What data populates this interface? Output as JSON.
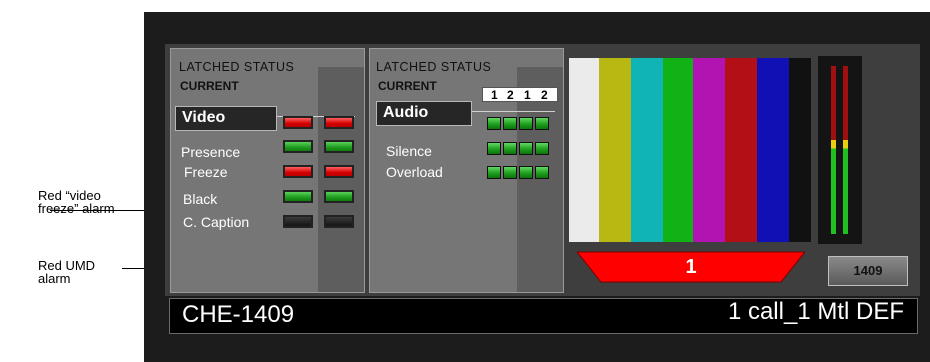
{
  "callouts": {
    "freeze_alarm": "Red “video freeze” alarm",
    "umd_alarm": "Red UMD alarm"
  },
  "video_panel": {
    "header": "LATCHED STATUS",
    "current": "CURRENT",
    "tab": "Video",
    "rows": [
      {
        "label": "Presence",
        "leds": [
          "green",
          "green"
        ]
      },
      {
        "label": "Freeze",
        "leds": [
          "red",
          "red"
        ]
      },
      {
        "label": "Black",
        "leds": [
          "green",
          "green"
        ]
      },
      {
        "label": "C. Caption",
        "leds": [
          "off",
          "off"
        ]
      }
    ],
    "header_leds": [
      "red",
      "red"
    ]
  },
  "audio_panel": {
    "header": "LATCHED STATUS",
    "current": "CURRENT",
    "tab": "Audio",
    "channels": [
      "1",
      "2",
      "1",
      "2"
    ],
    "rows": [
      {
        "label": "Silence",
        "leds": [
          "green",
          "green",
          "green",
          "green"
        ]
      },
      {
        "label": "Overload",
        "leds": [
          "green",
          "green",
          "green",
          "green"
        ]
      }
    ]
  },
  "color_bars": [
    "#ebebeb",
    "#b8b812",
    "#10b4b6",
    "#10b215",
    "#b214b2",
    "#b21016",
    "#1010b4",
    "#111111"
  ],
  "umd": {
    "text": "1",
    "color": "#ff0000"
  },
  "source_button": "1409",
  "bottom": {
    "left": "CHE-1409",
    "right": "1 call_1 Mtl DEF"
  }
}
